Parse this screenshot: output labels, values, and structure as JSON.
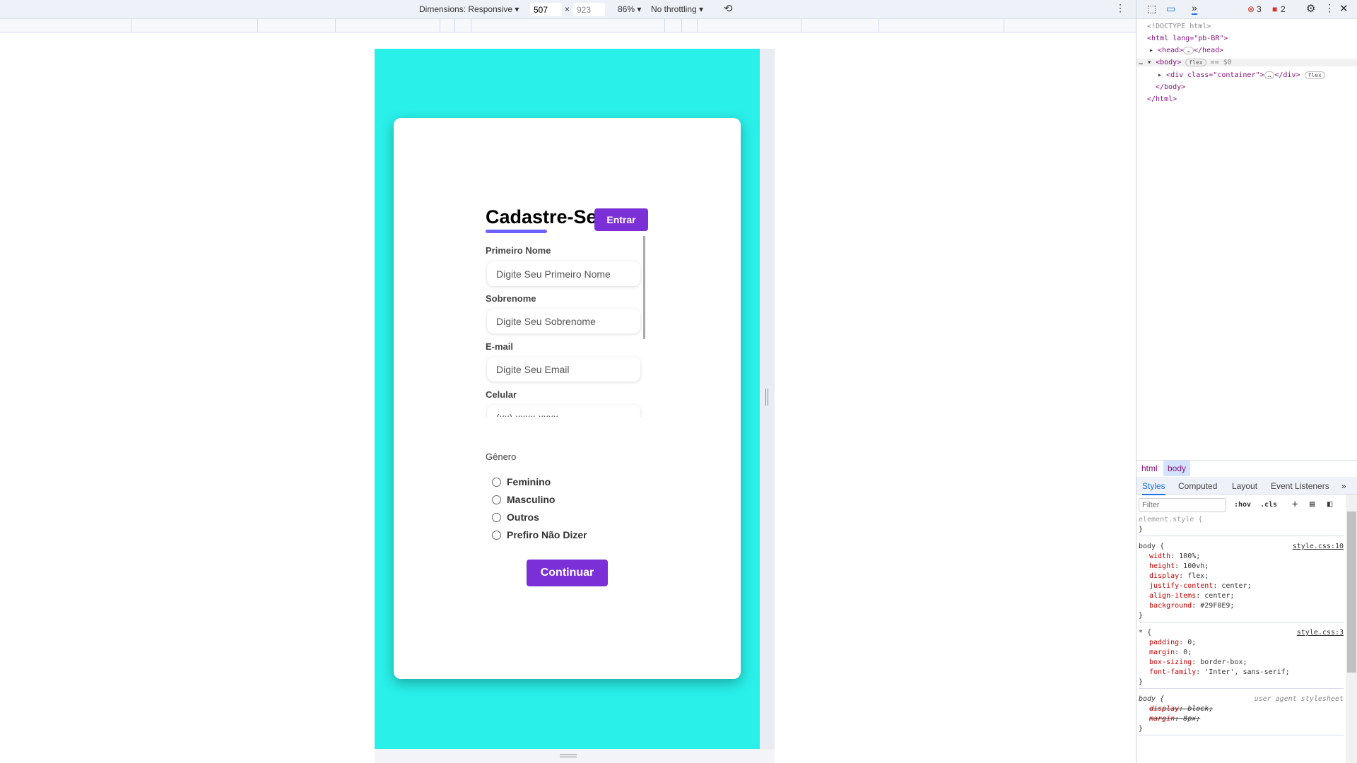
{
  "device_toolbar": {
    "dimensions": "Dimensions: Responsive ▾",
    "width": "507",
    "times": "×",
    "height": "923",
    "zoom": "86% ▾",
    "throttling": "No throttling ▾"
  },
  "form": {
    "title": "Cadastre-Se",
    "login_button": "Entrar",
    "fields": [
      {
        "label": "Primeiro Nome",
        "placeholder": "Digite Seu Primeiro Nome"
      },
      {
        "label": "Sobrenome",
        "placeholder": "Digite Seu Sobrenome"
      },
      {
        "label": "E-mail",
        "placeholder": "Digite Seu Email"
      },
      {
        "label": "Celular",
        "placeholder": "(xx) xxxx-xxxx"
      }
    ],
    "gender_label": "Gênero",
    "gender_options": [
      "Feminino",
      "Masculino",
      "Outros",
      "Prefiro Não Dizer"
    ],
    "submit": "Continuar"
  },
  "colors": {
    "background": "#29F0E9",
    "accent": "#7B2FD6",
    "underline": "#6C63FF"
  },
  "devtools": {
    "errors": "3",
    "warnings": "2",
    "dom": [
      "<!DOCTYPE html>",
      "<html lang=\"pb-BR\">",
      "<head>",
      "</head>",
      "<body>",
      "flex",
      "== $0",
      "<div class=\"container\">",
      "</div>",
      "flex",
      "</body>",
      "</html>"
    ],
    "breadcrumb": [
      "html",
      "body"
    ],
    "tabs": [
      "Styles",
      "Computed",
      "Layout",
      "Event Listeners"
    ],
    "filter_placeholder": "Filter",
    "hov": ":hov",
    "cls": ".cls",
    "rules": [
      {
        "selector": "element.style {",
        "source": "",
        "decls": []
      },
      {
        "selector": "body {",
        "source": "style.css:10",
        "decls": [
          [
            "width",
            "100%;"
          ],
          [
            "height",
            "100vh;"
          ],
          [
            "display",
            "flex;"
          ],
          [
            "justify-content",
            "center;"
          ],
          [
            "align-items",
            "center;"
          ],
          [
            "background",
            "#29F0E9;"
          ]
        ]
      },
      {
        "selector": "* {",
        "source": "style.css:3",
        "decls": [
          [
            "padding",
            "0;"
          ],
          [
            "margin",
            "0;"
          ],
          [
            "box-sizing",
            "border-box;"
          ],
          [
            "font-family",
            "'Inter', sans-serif;"
          ]
        ]
      },
      {
        "selector": "body {",
        "source": "user agent stylesheet",
        "decls": [
          [
            "display",
            "block;"
          ],
          [
            "margin",
            "8px;"
          ]
        ]
      }
    ]
  }
}
